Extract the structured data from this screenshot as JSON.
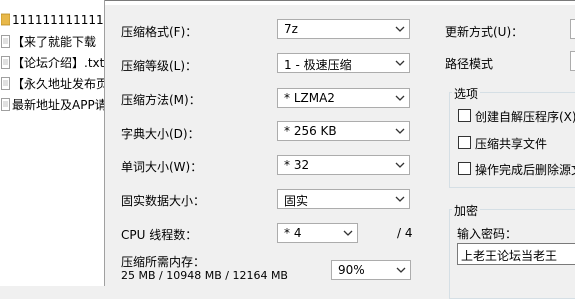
{
  "file_list": [
    {
      "name": "1111111111111"
    },
    {
      "name": "【来了就能下载"
    },
    {
      "name": "【论坛介绍】.txt"
    },
    {
      "name": "【永久地址发布页"
    },
    {
      "name": "最新地址及APP请"
    }
  ],
  "form": {
    "format_label": "压缩格式(F)：",
    "format_value": "7z",
    "level_label": "压缩等级(L)：",
    "level_value": "1 - 极速压缩",
    "method_label": "压缩方法(M)：",
    "method_value": "* LZMA2",
    "dict_label": "字典大小(D)：",
    "dict_value": "* 256 KB",
    "word_label": "单词大小(W)：",
    "word_value": "* 32",
    "solid_label": "固实数据大小：",
    "solid_value": "固实",
    "threads_label": "CPU 线程数：",
    "threads_value": "* 4",
    "threads_total": "/ 4",
    "memory_label": "压缩所需内存：",
    "memory_values": "25 MB / 10948 MB / 12164 MB",
    "memory_percent": "90%"
  },
  "right": {
    "update_label": "更新方式(U)：",
    "path_label": "路径模式",
    "options_title": "选项",
    "opt_sfx": "创建自解压程序(X)",
    "opt_shared": "压缩共享文件",
    "opt_delete": "操作完成后删除源文",
    "encrypt_title": "加密",
    "password_label": "输入密码：",
    "password_value": "上老王论坛当老王"
  },
  "colors": {
    "folder": "#e8b84a",
    "file": "#ffffff",
    "border": "#acacac"
  }
}
